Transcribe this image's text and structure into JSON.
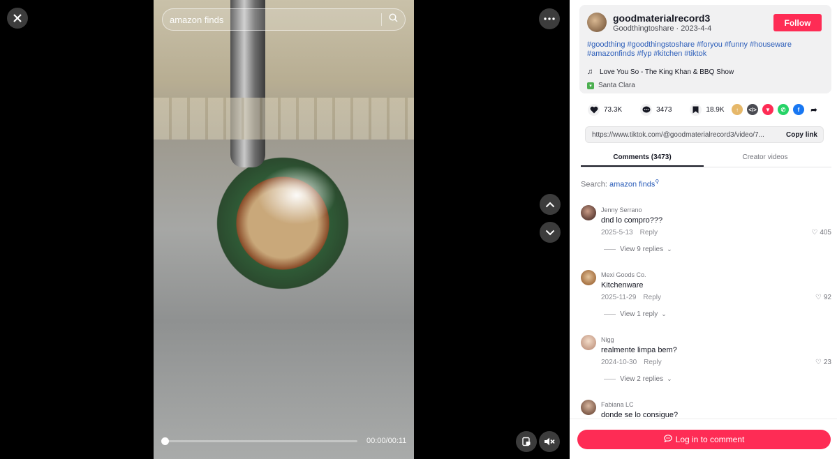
{
  "video": {
    "search_text": "amazon finds",
    "time_text": "00:00/00:11",
    "progress": 0.0
  },
  "author": {
    "name": "goodmaterialrecord3",
    "subtitle": "Goodthingtoshare · 2023-4-4",
    "follow_label": "Follow",
    "hashtags": "#goodthing #goodthingstoshare #foryou #funny #houseware #amazonfinds #fyp #kitchen #tiktok",
    "music": "Love You So - The King Khan & BBQ Show",
    "location": "Santa Clara"
  },
  "stats": {
    "likes": "73.3K",
    "comments": "3473",
    "saves": "18.9K"
  },
  "link": {
    "url": "https://www.tiktok.com/@goodmaterialrecord3/video/7...",
    "copy_label": "Copy link"
  },
  "tabs": {
    "comments": "Comments (3473)",
    "creator": "Creator videos"
  },
  "search": {
    "prefix": "Search: ",
    "keyword": "amazon finds"
  },
  "comments": [
    {
      "user": "Jenny Serrano",
      "text": "dnd lo compro???",
      "date": "2025-5-13",
      "reply_label": "Reply",
      "likes": "405",
      "replies": "View 9 replies"
    },
    {
      "user": "Mexi Goods Co.",
      "text": "Kitchenware",
      "date": "2025-11-29",
      "reply_label": "Reply",
      "likes": "92",
      "replies": "View 1 reply"
    },
    {
      "user": "Nigg",
      "text": "realmente limpa bem?",
      "date": "2024-10-30",
      "reply_label": "Reply",
      "likes": "23",
      "replies": "View 2 replies"
    },
    {
      "user": "Fabiana LC",
      "text": "donde se lo consigue?"
    }
  ],
  "login": {
    "label": "Log in to comment"
  },
  "colors": {
    "accent": "#fe2c55",
    "link": "#2b5db9"
  }
}
